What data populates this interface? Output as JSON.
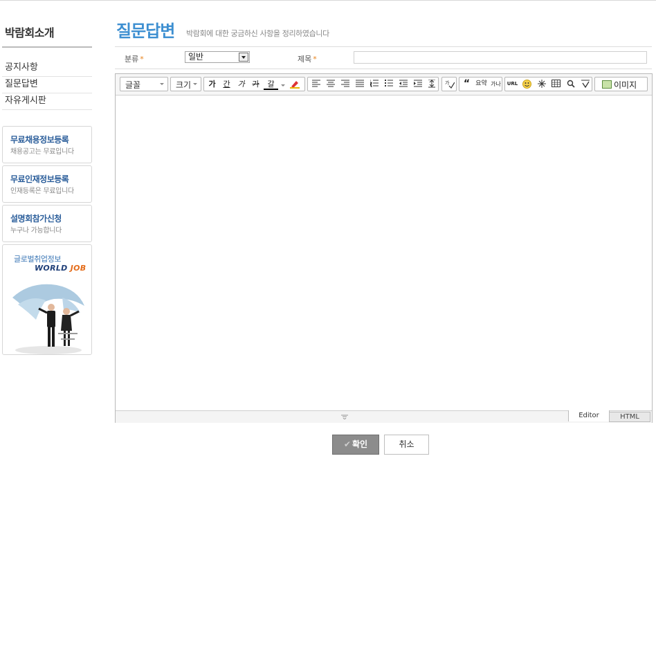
{
  "sidebar": {
    "title": "박람회소개",
    "menu": [
      "공지사항",
      "질문답변",
      "자유게시판"
    ],
    "promos": [
      {
        "title": "무료채용정보등록",
        "sub": "채용공고는 무료입니다"
      },
      {
        "title": "무료인재정보등록",
        "sub": "인재등록은 무료입니다"
      },
      {
        "title": "설명회참가신청",
        "sub": "누구나 가능합니다"
      }
    ],
    "worldjob": {
      "caption": "글로벌취업정보",
      "logo_a": "WORLD",
      "logo_b": "JOB"
    }
  },
  "header": {
    "title": "질문답변",
    "description": "박람회에 대한 궁금하신 사항을 정리하였습니다"
  },
  "form": {
    "category_label": "분류",
    "category_value": "일반",
    "subject_label": "제목",
    "required_mark": "*"
  },
  "toolbar": {
    "font_label": "글꼴",
    "size_label": "크기",
    "style_buttons": [
      "가",
      "간",
      "가",
      "가",
      "갈"
    ],
    "quote_buttons": [
      "“",
      "요약",
      "가나"
    ],
    "url_label": "URL",
    "image_label": "이미지",
    "icons": [
      "bold-icon",
      "underline-icon",
      "italic-icon",
      "strikethrough-icon",
      "text-color-icon",
      "background-color-icon",
      "align-left-icon",
      "align-center-icon",
      "align-right-icon",
      "align-justify-icon",
      "ordered-list-icon",
      "unordered-list-icon",
      "outdent-icon",
      "indent-icon",
      "line-height-icon",
      "spellcheck-icon",
      "quote-icon",
      "summary-icon",
      "character-icon",
      "url-icon",
      "emoticon-icon",
      "special-char-icon",
      "table-icon",
      "find-icon",
      "spell-icon",
      "image-icon"
    ]
  },
  "editor_tabs": {
    "editor": "Editor",
    "html": "HTML"
  },
  "buttons": {
    "ok": "확인",
    "cancel": "취소"
  },
  "colors": {
    "accent": "#3d8fd1",
    "promo": "#2a5d9a",
    "required": "#e8821c",
    "ok_bg": "#8c8c8c"
  }
}
